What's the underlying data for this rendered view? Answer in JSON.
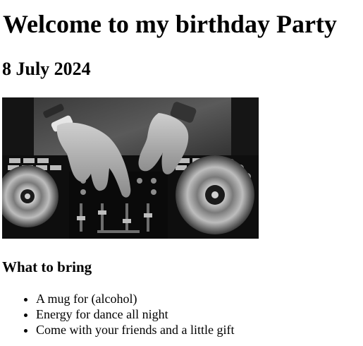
{
  "page": {
    "title": "Welcome to my birthday Party",
    "date": "8 July 2024"
  },
  "image": {
    "alt": "DJ hands on turntable controller",
    "icon": "dj-controller-photo"
  },
  "bring_section": {
    "heading": "What to bring",
    "items": [
      "A mug for (alcohol)",
      "Energy for dance all night",
      "Come with your friends and a little gift"
    ]
  }
}
